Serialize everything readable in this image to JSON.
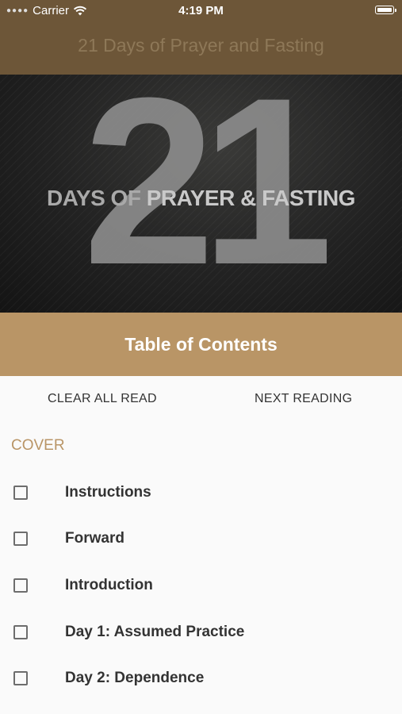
{
  "status_bar": {
    "carrier": "Carrier",
    "time": "4:19 PM"
  },
  "nav": {
    "title": "21 Days of Prayer and Fasting"
  },
  "hero": {
    "number": "21",
    "tagline_part1": "DAYS OF ",
    "tagline_part2": "PRAYER & FASTING"
  },
  "toc": {
    "header": "Table of Contents",
    "clear_all_label": "CLEAR ALL READ",
    "next_reading_label": "NEXT READING",
    "section": "COVER",
    "items": [
      {
        "label": "Instructions",
        "checked": false
      },
      {
        "label": "Forward",
        "checked": false
      },
      {
        "label": "Introduction",
        "checked": false
      },
      {
        "label": "Day 1: Assumed Practice",
        "checked": false
      },
      {
        "label": "Day 2: Dependence",
        "checked": false
      }
    ]
  },
  "colors": {
    "nav_bg": "#6d5638",
    "accent": "#b99566"
  }
}
